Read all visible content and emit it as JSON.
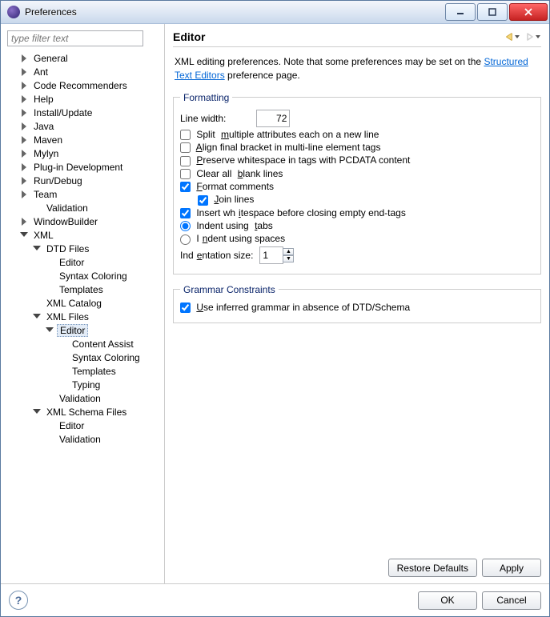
{
  "window": {
    "title": "Preferences"
  },
  "filter": {
    "placeholder": "type filter text"
  },
  "tree": [
    {
      "label": "General",
      "depth": 1,
      "expand": "collapsed"
    },
    {
      "label": "Ant",
      "depth": 1,
      "expand": "collapsed"
    },
    {
      "label": "Code Recommenders",
      "depth": 1,
      "expand": "collapsed"
    },
    {
      "label": "Help",
      "depth": 1,
      "expand": "collapsed"
    },
    {
      "label": "Install/Update",
      "depth": 1,
      "expand": "collapsed"
    },
    {
      "label": "Java",
      "depth": 1,
      "expand": "collapsed"
    },
    {
      "label": "Maven",
      "depth": 1,
      "expand": "collapsed"
    },
    {
      "label": "Mylyn",
      "depth": 1,
      "expand": "collapsed"
    },
    {
      "label": "Plug-in Development",
      "depth": 1,
      "expand": "collapsed"
    },
    {
      "label": "Run/Debug",
      "depth": 1,
      "expand": "collapsed"
    },
    {
      "label": "Team",
      "depth": 1,
      "expand": "collapsed"
    },
    {
      "label": "Validation",
      "depth": 2,
      "expand": "none"
    },
    {
      "label": "WindowBuilder",
      "depth": 1,
      "expand": "collapsed"
    },
    {
      "label": "XML",
      "depth": 1,
      "expand": "expanded"
    },
    {
      "label": "DTD Files",
      "depth": 2,
      "expand": "expanded"
    },
    {
      "label": "Editor",
      "depth": 3,
      "expand": "none"
    },
    {
      "label": "Syntax Coloring",
      "depth": 3,
      "expand": "none"
    },
    {
      "label": "Templates",
      "depth": 3,
      "expand": "none"
    },
    {
      "label": "XML Catalog",
      "depth": 2,
      "expand": "none"
    },
    {
      "label": "XML Files",
      "depth": 2,
      "expand": "expanded"
    },
    {
      "label": "Editor",
      "depth": 3,
      "expand": "expanded",
      "selected": true
    },
    {
      "label": "Content Assist",
      "depth": 4,
      "expand": "none"
    },
    {
      "label": "Syntax Coloring",
      "depth": 4,
      "expand": "none"
    },
    {
      "label": "Templates",
      "depth": 4,
      "expand": "none"
    },
    {
      "label": "Typing",
      "depth": 4,
      "expand": "none"
    },
    {
      "label": "Validation",
      "depth": 3,
      "expand": "none"
    },
    {
      "label": "XML Schema Files",
      "depth": 2,
      "expand": "expanded"
    },
    {
      "label": "Editor",
      "depth": 3,
      "expand": "none"
    },
    {
      "label": "Validation",
      "depth": 3,
      "expand": "none"
    }
  ],
  "page": {
    "heading": "Editor",
    "desc_pre": "XML editing preferences.  Note that some preferences may be set on the ",
    "desc_link": "Structured Text Editors",
    "desc_post": " preference page."
  },
  "formatting": {
    "legend": "Formatting",
    "line_width_label": "Line width:",
    "line_width_value": "72",
    "split_attrs": {
      "label_pre": "Split ",
      "u": "m",
      "label_post": "ultiple attributes each on a new line",
      "checked": false
    },
    "align_bracket": {
      "u": "A",
      "label": "lign final bracket in multi-line element tags",
      "checked": false
    },
    "preserve_ws": {
      "u": "P",
      "label": "reserve whitespace in tags with PCDATA content",
      "checked": false
    },
    "clear_blank": {
      "label_pre": "Clear all ",
      "u": "b",
      "label_post": "lank lines",
      "checked": false
    },
    "fmt_comments": {
      "u": "F",
      "label": "ormat comments",
      "checked": true
    },
    "join_lines": {
      "u": "J",
      "label": "oin lines",
      "checked": true
    },
    "insert_ws": {
      "label_pre": "Insert wh",
      "u": "i",
      "label_post": "tespace before closing empty end-tags",
      "checked": true
    },
    "indent_tabs": {
      "label_pre": "Indent using ",
      "u": "t",
      "label_post": "abs",
      "checked": true
    },
    "indent_spaces": {
      "label_pre": "I",
      "u": "n",
      "label_post": "dent using spaces",
      "checked": false
    },
    "indent_size_label_pre": "Ind",
    "indent_size_u": "e",
    "indent_size_label_post": "ntation size:",
    "indent_size_value": "1"
  },
  "grammar": {
    "legend": "Grammar Constraints",
    "use_inferred": {
      "u": "U",
      "label": "se inferred grammar in absence of DTD/Schema",
      "checked": true
    }
  },
  "buttons": {
    "restore": "Restore Defaults",
    "apply": "Apply",
    "ok": "OK",
    "cancel": "Cancel"
  }
}
